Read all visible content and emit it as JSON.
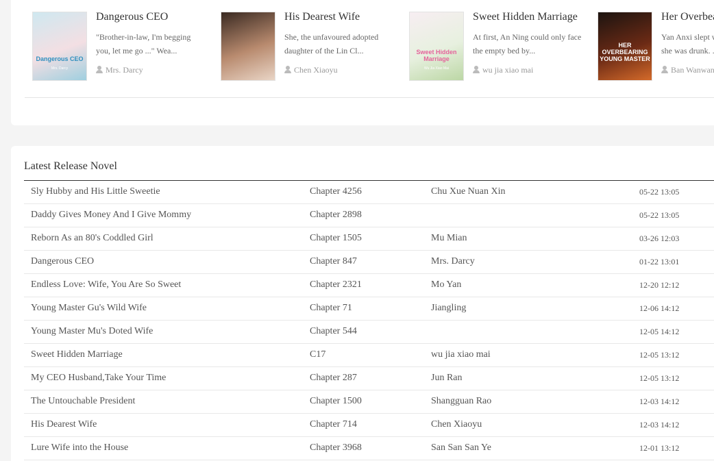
{
  "featured": [
    {
      "title": "Dangerous CEO",
      "desc": "\"Brother-in-law, I'm begging you, let me go ...\" Wea...",
      "author": "Mrs. Darcy",
      "cover_text": "Dangerous CEO",
      "cover_author": "Mrs. Darcy",
      "cover_colors": [
        "#cfe8f0",
        "#f3dfe3",
        "#9fcfdf"
      ],
      "cover_text_color": "#2f8fbf",
      "link": true
    },
    {
      "title": "His Dearest Wife",
      "desc": "She, the unfavoured adopted daughter of the Lin Cl...",
      "author": "Chen Xiaoyu",
      "cover_text": "",
      "cover_author": "",
      "cover_colors": [
        "#3a2a22",
        "#b88a6e",
        "#e9d5c6"
      ],
      "cover_text_color": "#ffffff",
      "link": true
    },
    {
      "title": "Sweet Hidden Marriage",
      "desc": "At first, An Ning could only face the empty bed by...",
      "author": "wu jia xiao mai",
      "cover_text": "Sweet Hidden Marriage",
      "cover_author": "Wu Jia Xiao Mai",
      "cover_colors": [
        "#f7eef2",
        "#e7f0df",
        "#bcd7a5"
      ],
      "cover_text_color": "#e4639a",
      "link": true
    },
    {
      "title": "Her Overbearing Young Master",
      "desc": "Yan Anxi slept with him when she was drunk. ...",
      "author": "Ban Wanwan",
      "cover_text": "HER OVERBEARING YOUNG MASTER",
      "cover_author": "",
      "cover_colors": [
        "#1c1410",
        "#6b2a15",
        "#d46a2a"
      ],
      "cover_text_color": "#ffffff",
      "link": true
    }
  ],
  "latest": {
    "heading": "Latest Release Novel",
    "rows": [
      {
        "title": "Sly Hubby and His Little Sweetie",
        "chapter": "Chapter 4256",
        "author": "Chu Xue Nuan Xin",
        "time": "05-22 13:05"
      },
      {
        "title": "Daddy Gives Money And I Give Mommy",
        "chapter": "Chapter 2898",
        "author": "",
        "time": "05-22 13:05"
      },
      {
        "title": "Reborn As an 80's Coddled Girl",
        "chapter": "Chapter 1505",
        "author": "Mu Mian",
        "time": "03-26 12:03"
      },
      {
        "title": "Dangerous CEO",
        "chapter": "Chapter 847",
        "author": "Mrs. Darcy",
        "time": "01-22 13:01"
      },
      {
        "title": "Endless Love: Wife, You Are So Sweet",
        "chapter": "Chapter 2321",
        "author": "Mo Yan",
        "time": "12-20 12:12"
      },
      {
        "title": "Young Master Gu's Wild Wife",
        "chapter": "Chapter 71",
        "author": "Jiangling",
        "time": "12-06 14:12"
      },
      {
        "title": "Young Master Mu's Doted Wife",
        "chapter": "Chapter 544",
        "author": "",
        "time": "12-05 14:12"
      },
      {
        "title": "Sweet Hidden Marriage",
        "chapter": "C17",
        "author": "wu jia xiao mai",
        "time": "12-05 13:12"
      },
      {
        "title": "My CEO Husband,Take Your Time",
        "chapter": "Chapter 287",
        "author": "Jun Ran",
        "time": "12-05 13:12"
      },
      {
        "title": "The Untouchable President",
        "chapter": "Chapter 1500",
        "author": "Shangguan Rao",
        "time": "12-03 14:12"
      },
      {
        "title": "His Dearest Wife",
        "chapter": "Chapter 714",
        "author": "Chen Xiaoyu",
        "time": "12-03 14:12"
      },
      {
        "title": "Lure Wife into the House",
        "chapter": "Chapter 3968",
        "author": "San San San Ye",
        "time": "12-01 13:12"
      }
    ]
  }
}
